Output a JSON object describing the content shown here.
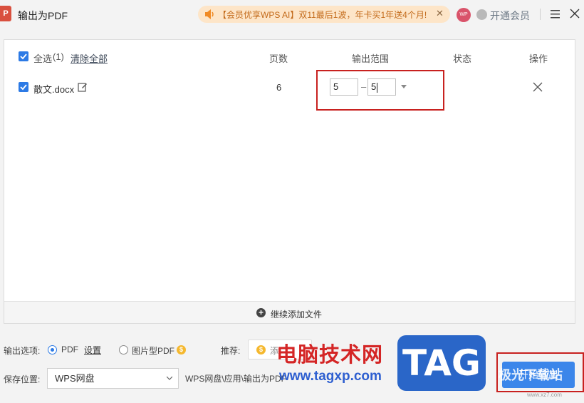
{
  "window": {
    "app_icon": "P",
    "title": "输出为PDF",
    "promo_text": "【会员优享WPS AI】双11最后1波，年卡买1年送4个月!",
    "avatar_text": "WP",
    "vip_link": "开通会员"
  },
  "list": {
    "select_all_label": "全选",
    "select_all_count": "(1)",
    "clear_all": "清除全部",
    "columns": [
      "页数",
      "输出范围",
      "状态",
      "操作"
    ],
    "rows": [
      {
        "file_name": "散文.docx",
        "pages": "6",
        "range_from": "5",
        "range_to": "5",
        "status": ""
      }
    ],
    "add_more": "继续添加文件"
  },
  "options": {
    "output_label": "输出选项:",
    "format_pdf": "PDF",
    "settings_link": "设置",
    "format_image_pdf": "图片型PDF",
    "recommend_label": "推荐:",
    "recommend_value": "添",
    "save_label": "保存位置:",
    "save_location": "WPS网盘",
    "save_path": "WPS网盘\\应用\\输出为PDF",
    "start_button": "开始输出"
  },
  "watermark": {
    "site_name": "电脑技术网",
    "site_url": "www.tagxp.com",
    "tag": "TAG",
    "corner_name": "极光下载站",
    "corner_url": "www.xz7.com"
  },
  "colors": {
    "accent": "#2c7ae5",
    "button": "#3b86ea",
    "highlight": "#c8211f",
    "promo_bg": "#fde5c8"
  }
}
